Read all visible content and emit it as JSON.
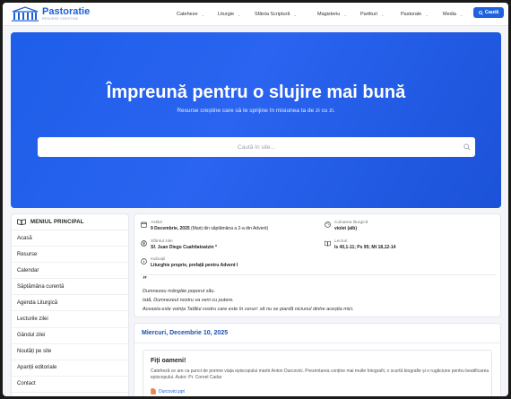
{
  "brand": {
    "title": "Pastoratie",
    "subtitle": "RESURSE CRESTINE"
  },
  "nav": {
    "items": [
      {
        "label": "Cateheze"
      },
      {
        "label": "Liturgie"
      },
      {
        "label": "Sfânta Scriptură"
      },
      {
        "label": "Magisteriu"
      },
      {
        "label": "Partituri"
      },
      {
        "label": "Pastorale"
      },
      {
        "label": "Media"
      }
    ],
    "search_label": "Caută"
  },
  "hero": {
    "title": "Împreună pentru o slujire mai bună",
    "subtitle": "Resurse creștine care să te sprijine în misiunea ta de zi cu zi.",
    "search_placeholder": "Caută în site..."
  },
  "sidebar": {
    "title": "MENIUL PRINCIPAL",
    "items": [
      {
        "label": "Acasă"
      },
      {
        "label": "Resurse"
      },
      {
        "label": "Calendar"
      },
      {
        "label": "Săptămâna curentă"
      },
      {
        "label": "Agenda Liturgică"
      },
      {
        "label": "Lecturile zilei"
      },
      {
        "label": "Gândul zilei"
      },
      {
        "label": "Noutăți pe site"
      },
      {
        "label": "Apariții editoriale"
      },
      {
        "label": "Contact"
      }
    ]
  },
  "today": {
    "date_label": "Astăzi",
    "date_value": "9 Decembrie, 2025",
    "date_note": "(Marți din săptămâna a 2-a din Advent)",
    "saint_label": "Sfântul zilei",
    "saint_value": "Sf. Juan Diego Cuahtlatoatzin *",
    "color_label": "Culoarea liturgică",
    "color_value": "violet (alb)",
    "readings_label": "Lecturi",
    "readings_value": "Is 40,1-11; Ps 95; Mt 18,12-14",
    "indications_label": "Indicații",
    "indications_value": "Liturghie proprie, prefață pentru Advent I",
    "quote_lines": [
      "Dumnezeu mângâie poporul său.",
      "Iată, Dumnezeul nostru va veni cu putere.",
      "Aceasta este voința Tatălui vostru care este în ceruri: să nu se piardă niciunul dintre aceștia mici."
    ]
  },
  "upcoming": {
    "date": "Miercuri, Decembrie 10, 2025",
    "card_title": "Fiți oameni!",
    "card_text": "Cateheză ce are ca punct de pornire viața episcopului martir Anton Durcovici. Prezentarea conține mai multe fotografii, o scurtă biografie și o rugăciune pentru beatificarea episcopului. Autor: Pr. Cornel Cadar",
    "card_file": "Durcovici.ppt"
  },
  "colors": {
    "accent": "#1f62e0",
    "hero": "#2a64f0",
    "link": "#1b5fd6"
  }
}
